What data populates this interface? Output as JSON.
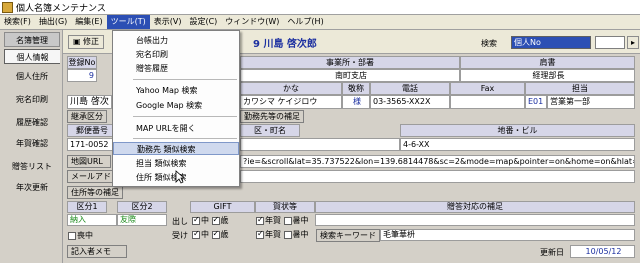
{
  "window": {
    "title": "個人名簿メンテナンス"
  },
  "menubar": [
    {
      "label": "検索(F)"
    },
    {
      "label": "抽出(G)"
    },
    {
      "label": "編集(E)"
    },
    {
      "label": "ツール(T)"
    },
    {
      "label": "表示(V)"
    },
    {
      "label": "設定(C)"
    },
    {
      "label": "ウィンドウ(W)"
    },
    {
      "label": "ヘルプ(H)"
    }
  ],
  "leftnav": {
    "header": "名簿管理",
    "items": [
      "個人情報",
      "個人住所",
      "宛名印刷",
      "履歴確認",
      "年賀確認",
      "贈答リスト",
      "年次更新"
    ]
  },
  "toolbar": {
    "edit_label": "修正",
    "person_name": "9 川島 啓次郎",
    "search_label": "検索",
    "search_value": "個人No"
  },
  "record": {
    "header_labels": [
      "登録No",
      "事業所・部署",
      "肩書"
    ],
    "reg_no": "9",
    "office": "南町支店",
    "title": "経理部長",
    "kana_header": "かな",
    "honorific_header": "敬称",
    "phone_header": "電話",
    "fax_header": "Fax",
    "staff_header": "担当",
    "name": "川島 啓次",
    "kana": "カワシマ ケイジロウ",
    "honorific": "様",
    "phone": "03-3565-XX2X",
    "staff_code": "E01",
    "staff_name": "営業第一部"
  },
  "sections": {
    "address_tab_1": "継承区分",
    "address_tab_2": "勤務先等の補足",
    "postal_header": "郵便番号",
    "ward_header": "区・町名",
    "building_header": "地番・ビル",
    "postal_value": "171-0052",
    "street": "4-6-XX",
    "map_url_label": "地図URL",
    "map_url": "?ie=&scroll&lat=35.737522&lon=139.6814478&sc=2&mode=map&pointer=on&home=on&hlat=35.788",
    "mail_label": "メールアドレス",
    "residence_label": "住所等の補足"
  },
  "category": {
    "kubun1": "区分1",
    "kubun2": "区分2",
    "kubun1_value": "納入",
    "kubun2_value": "友際",
    "gift_label": "GIFT",
    "greeting_label": "賀状等",
    "supplement_label": "贈答対応の補足",
    "send_label": "出し",
    "recv_label": "受け",
    "chu": "中",
    "sai": "歳",
    "nenga": "年賀",
    "shochu": "暑中",
    "kihan_label": "喪中",
    "keyword_label": "検索キーワード",
    "keyword_value": "毛筆華枡",
    "memo_label": "記入者メモ",
    "updated_label": "更新日",
    "updated_value": "10/05/12"
  },
  "tools_menu": {
    "items": [
      "台帳出力",
      "宛名印刷",
      "贈答履歴",
      "Yahoo Map 検索",
      "Google Map 検索",
      "MAP URLを開く",
      "勤務先 類似検索",
      "担当 類似検索",
      "住所 類似検索"
    ],
    "highlighted": "勤務先 類似検索"
  }
}
